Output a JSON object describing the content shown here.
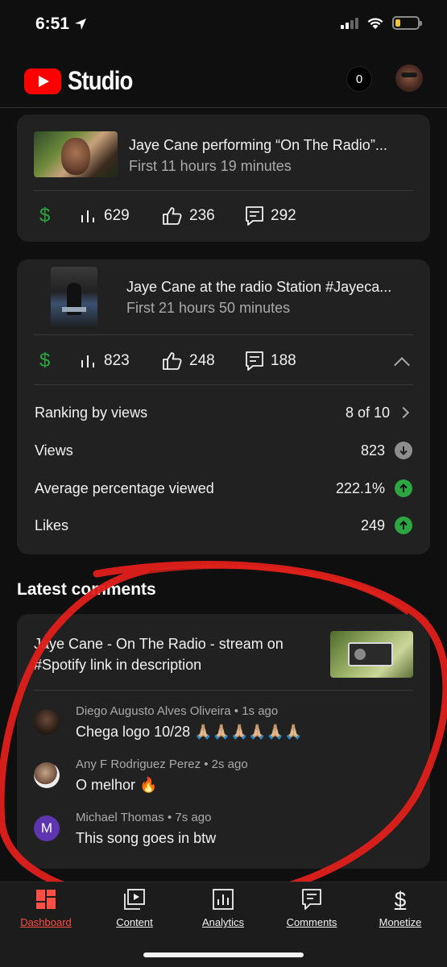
{
  "status_bar": {
    "time": "6:51"
  },
  "header": {
    "app_name": "Studio",
    "notification_count": "0"
  },
  "videos": [
    {
      "title": "Jaye Cane performing “On The Radio”...",
      "subtitle": "First 11 hours 19 minutes",
      "views": "629",
      "likes": "236",
      "comments": "292"
    },
    {
      "title": "Jaye Cane at the radio Station #Jayeca...",
      "subtitle": "First 21 hours 50 minutes",
      "views": "823",
      "likes": "248",
      "comments": "188",
      "stats": [
        {
          "label": "Ranking by views",
          "value": "8 of 10",
          "indicator": "chevron-right"
        },
        {
          "label": "Views",
          "value": "823",
          "indicator": "down-gray"
        },
        {
          "label": "Average percentage viewed",
          "value": "222.1%",
          "indicator": "up-green"
        },
        {
          "label": "Likes",
          "value": "249",
          "indicator": "up-green"
        }
      ]
    }
  ],
  "latest_comments": {
    "title": "Latest comments",
    "video_title": "Jaye Cane - On The Radio - stream on #Spotify link in description",
    "comments": [
      {
        "author": "Diego Augusto Alves Oliveira",
        "time": "1s ago",
        "text": "Chega logo 10/28 🙏🏼🙏🏼🙏🏼🙏🏼🙏🏼🙏🏼"
      },
      {
        "author": "Any F Rodriguez Perez",
        "time": "2s ago",
        "text": "O melhor 🔥"
      },
      {
        "author": "Michael Thomas",
        "time": "7s ago",
        "text": "This song goes in btw",
        "initial": "M"
      }
    ]
  },
  "bottom_nav": [
    {
      "label": "Dashboard",
      "active": true
    },
    {
      "label": "Content"
    },
    {
      "label": "Analytics"
    },
    {
      "label": "Comments"
    },
    {
      "label": "Monetize"
    }
  ],
  "colors": {
    "accent_red": "#ff4e45",
    "youtube_red": "#ff0000",
    "green": "#2ba640",
    "card_bg": "#212121",
    "annotation_red": "#e0201b"
  }
}
